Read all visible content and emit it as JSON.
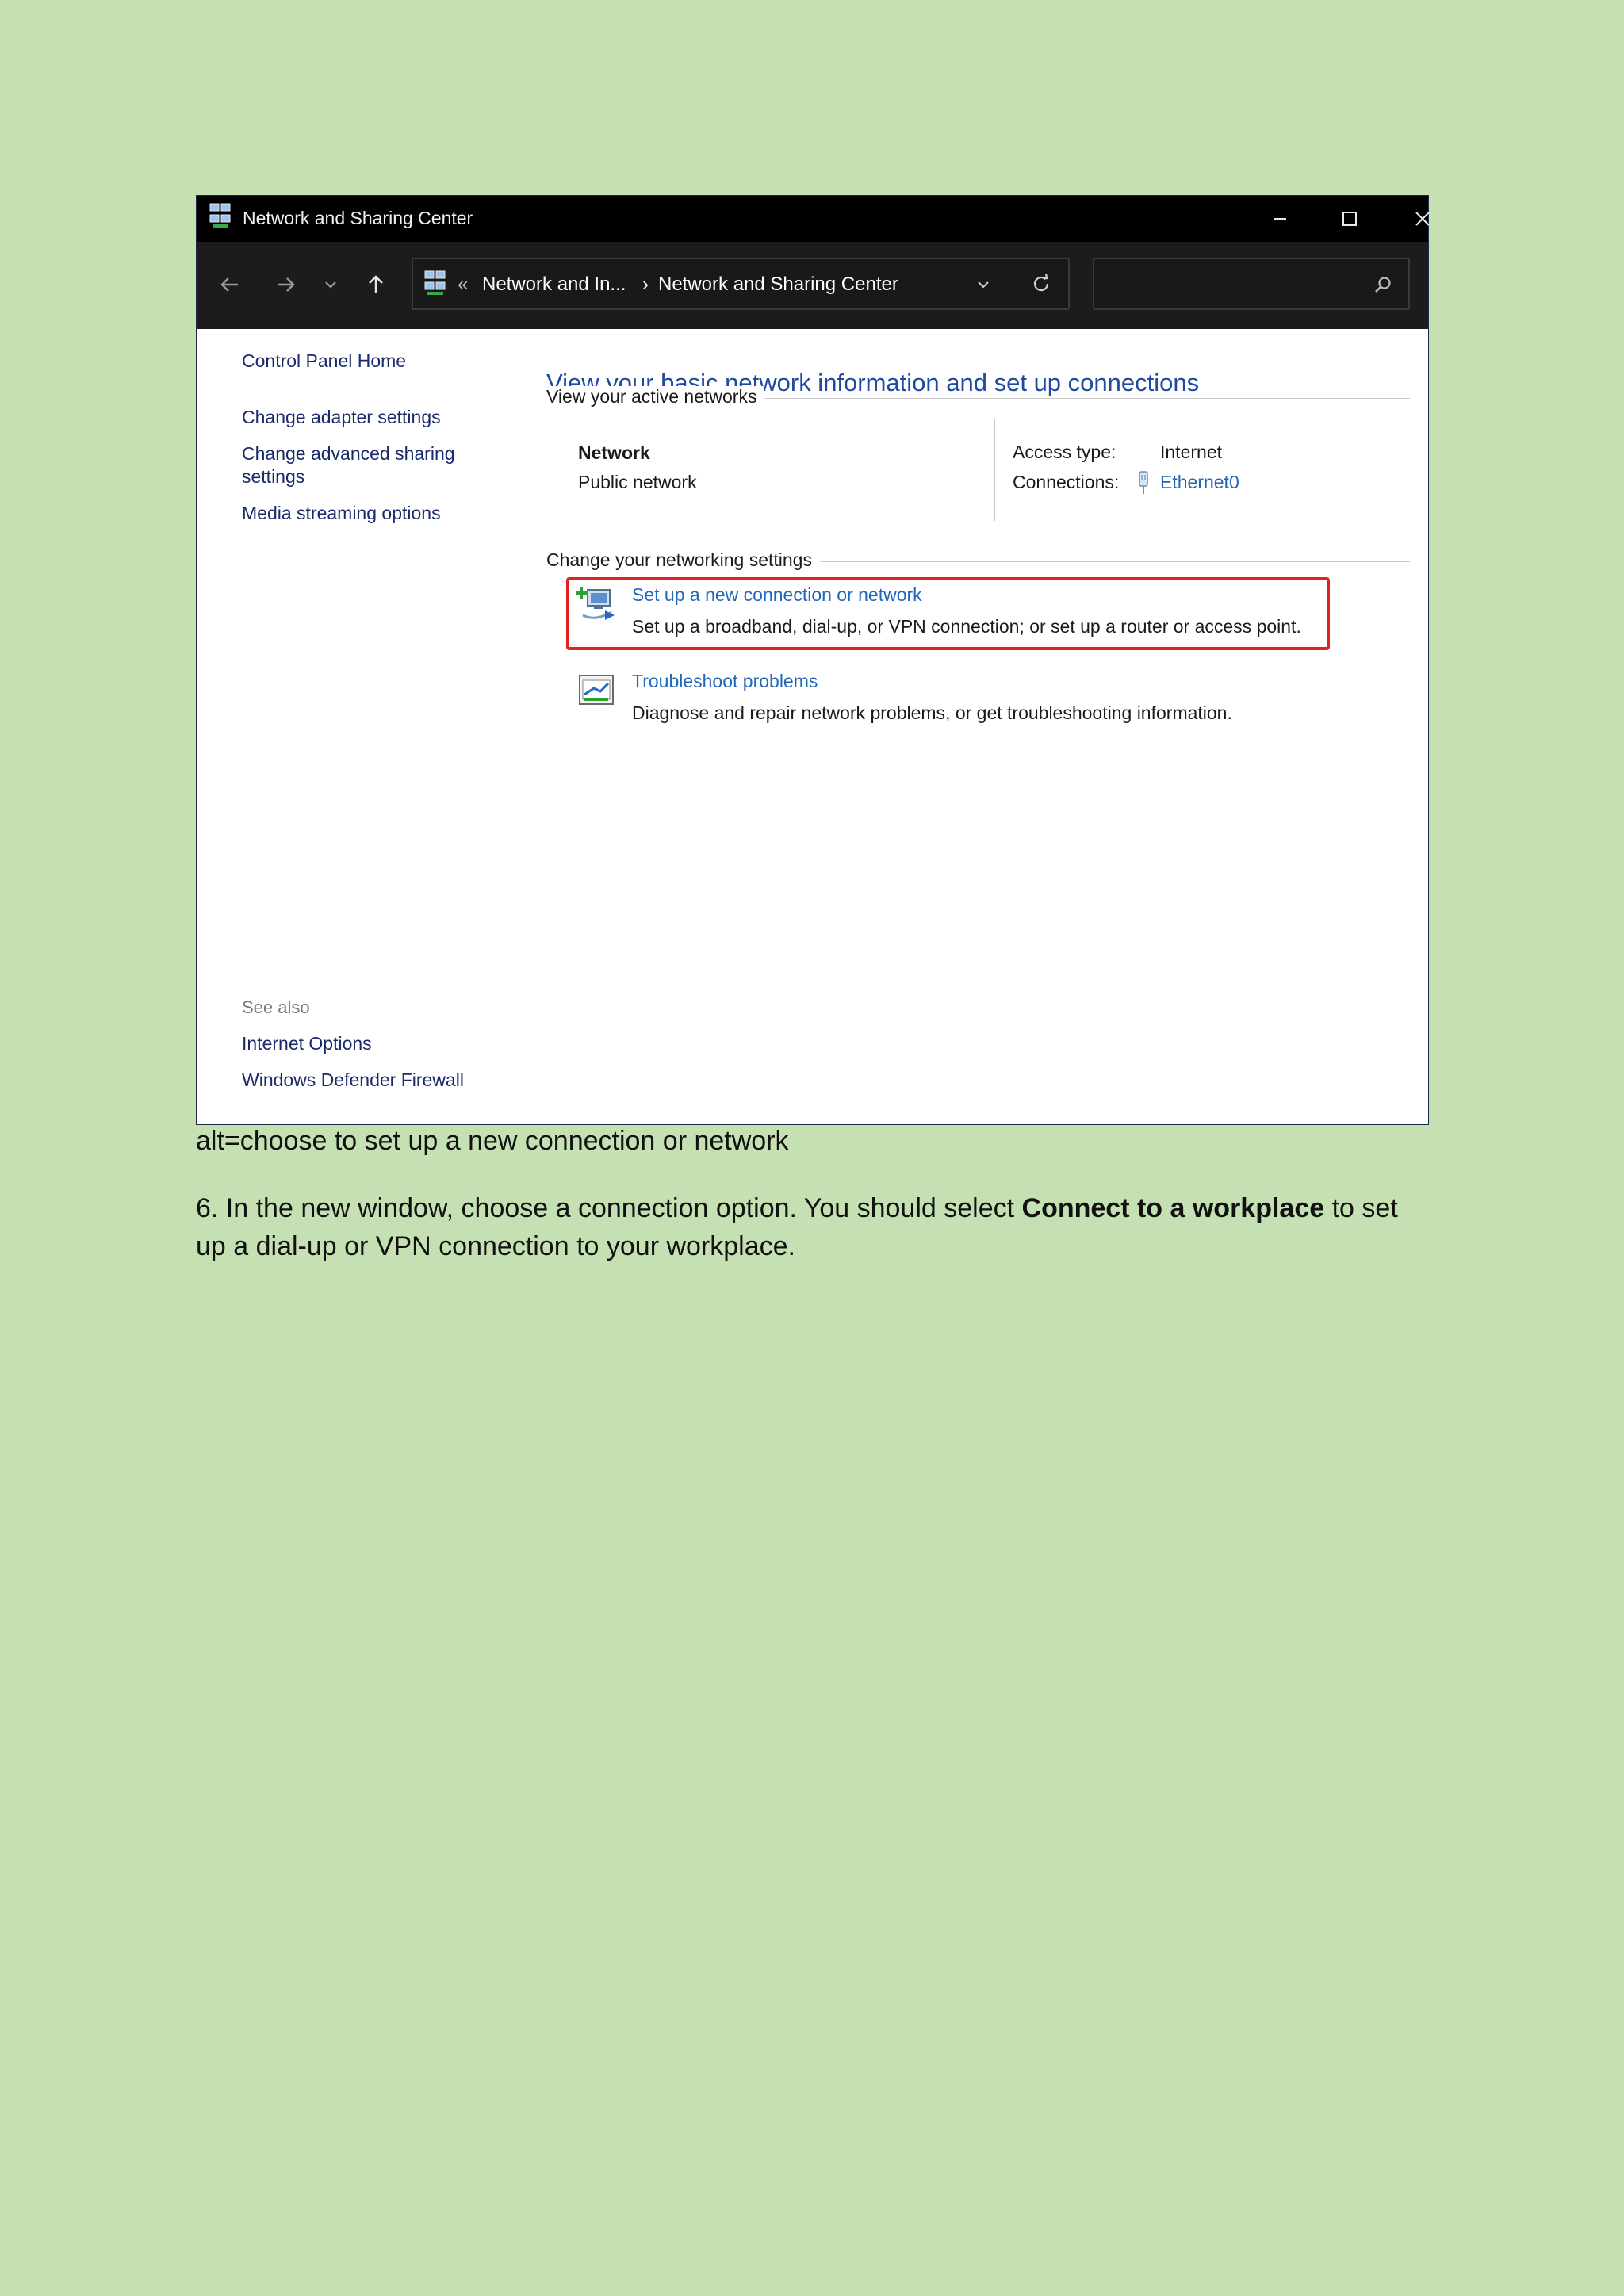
{
  "window": {
    "title": "Network and Sharing Center",
    "address": {
      "overflow": "«",
      "crumb1": "Network and In...",
      "separator": "›",
      "crumb2": "Network and Sharing Center"
    },
    "search": {
      "placeholder": ""
    }
  },
  "sidebar": {
    "home": "Control Panel Home",
    "links": [
      "Change adapter settings",
      "Change advanced sharing",
      "settings",
      "Media streaming options"
    ],
    "see_also_label": "See also",
    "see_also": [
      "Internet Options",
      "Windows Defender Firewall"
    ]
  },
  "main": {
    "heading": "View your basic network information and set up connections",
    "active_networks_label": "View your active networks",
    "network_name": "Network",
    "network_type": "Public network",
    "access_type_label": "Access type:",
    "access_type_value": "Internet",
    "connections_label": "Connections:",
    "connections_value": "Ethernet0",
    "change_settings_label": "Change your networking settings",
    "task1_link": "Set up a new connection or network",
    "task1_desc": "Set up a broadband, dial-up, or VPN connection; or set up a router or access point.",
    "task2_link": "Troubleshoot problems",
    "task2_desc": "Diagnose and repair network problems, or get troubleshooting information."
  },
  "document": {
    "caption": "alt=choose to set up a new connection or network",
    "para_before": "6. In the new window, choose a connection option. You should select ",
    "para_bold": "Connect to a workplace",
    "para_after": " to set up a dial-up or VPN connection to your workplace."
  },
  "colors": {
    "page_background": "#c5e1b3",
    "highlight_border": "#e0231f",
    "link": "#2267b8",
    "heading": "#1f4aa0"
  }
}
